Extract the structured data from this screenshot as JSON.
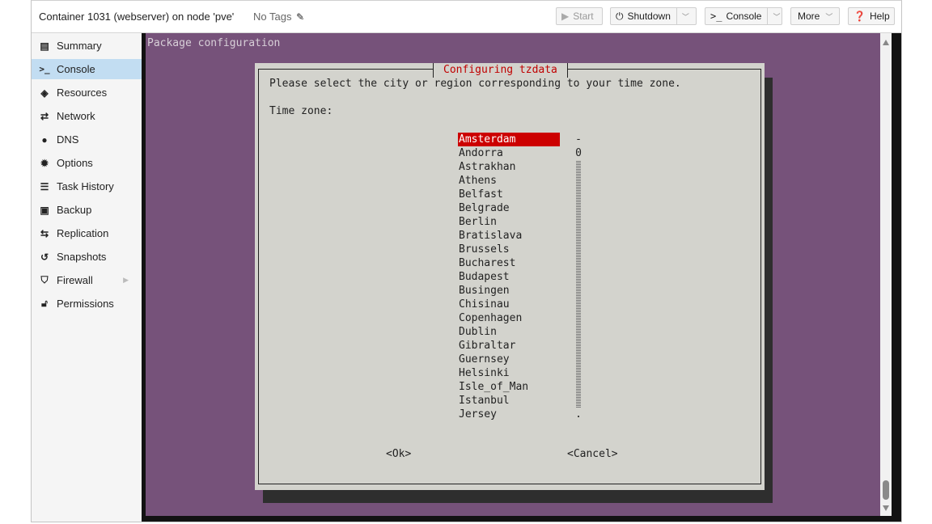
{
  "header": {
    "title": "Container 1031 (webserver) on node 'pve'",
    "tags_label": "No Tags",
    "buttons": {
      "start": "Start",
      "shutdown": "Shutdown",
      "console": "Console",
      "more": "More",
      "help": "Help"
    }
  },
  "sidebar": {
    "items": [
      {
        "label": "Summary",
        "icon": "book-icon"
      },
      {
        "label": "Console",
        "icon": "terminal-icon"
      },
      {
        "label": "Resources",
        "icon": "cube-icon"
      },
      {
        "label": "Network",
        "icon": "exchange-icon"
      },
      {
        "label": "DNS",
        "icon": "globe-icon"
      },
      {
        "label": "Options",
        "icon": "gear-icon"
      },
      {
        "label": "Task History",
        "icon": "list-icon"
      },
      {
        "label": "Backup",
        "icon": "floppy-icon"
      },
      {
        "label": "Replication",
        "icon": "retweet-icon"
      },
      {
        "label": "Snapshots",
        "icon": "history-icon"
      },
      {
        "label": "Firewall",
        "icon": "shield-icon"
      },
      {
        "label": "Permissions",
        "icon": "unlock-icon"
      }
    ],
    "active": "Console"
  },
  "terminal": {
    "screen_title": "Package configuration",
    "dialog_title": "Configuring tzdata",
    "prompt": "Please select the city or region corresponding to your time zone.",
    "field_label": "Time zone:",
    "options": [
      "Amsterdam",
      "Andorra",
      "Astrakhan",
      "Athens",
      "Belfast",
      "Belgrade",
      "Berlin",
      "Bratislava",
      "Brussels",
      "Bucharest",
      "Budapest",
      "Busingen",
      "Chisinau",
      "Copenhagen",
      "Dublin",
      "Gibraltar",
      "Guernsey",
      "Helsinki",
      "Isle_of_Man",
      "Istanbul",
      "Jersey"
    ],
    "selected": "Amsterdam",
    "scroll_marks": {
      "top": "-",
      "pos": "0",
      "bottom": "."
    },
    "ok_label": "<Ok>",
    "cancel_label": "<Cancel>"
  },
  "colors": {
    "terminal_bg": "#76527a",
    "dialog_bg": "#d3d3cd",
    "dialog_title": "#c00000",
    "selection": "#cc0000",
    "sidebar_active": "#c2ddf2"
  }
}
